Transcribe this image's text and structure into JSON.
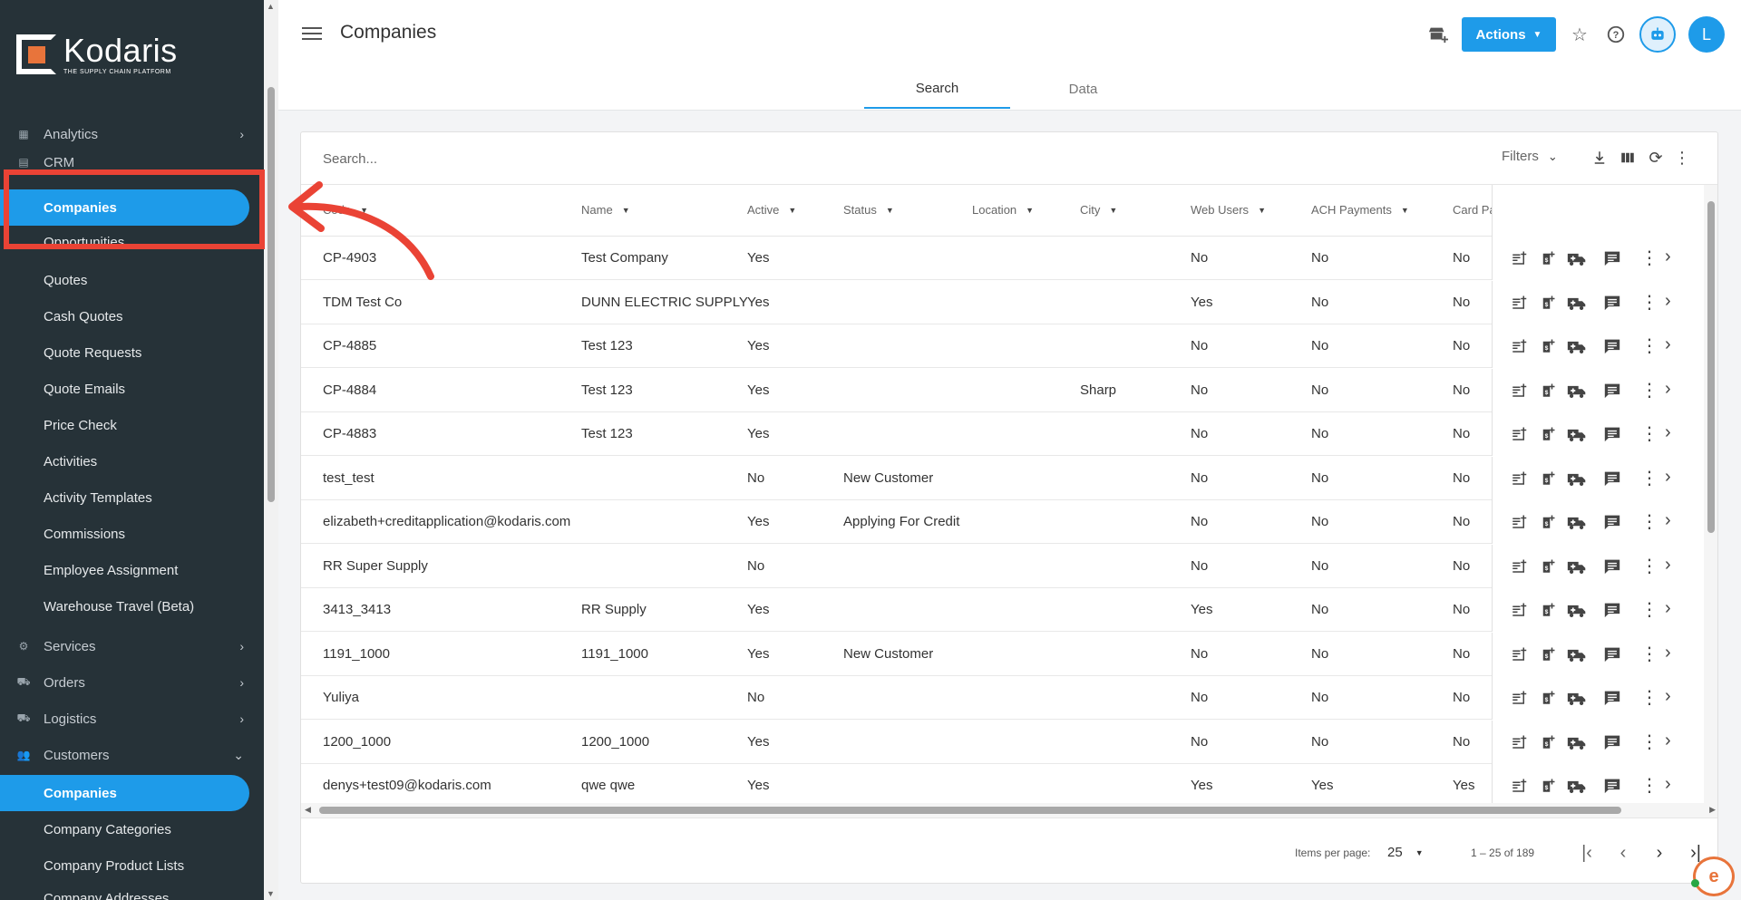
{
  "brand": {
    "name": "Kodaris",
    "tagline": "THE SUPPLY CHAIN PLATFORM"
  },
  "sidebar": {
    "sections": [
      {
        "label": "Analytics",
        "icon": "chart-icon",
        "chevron": "›"
      },
      {
        "label": "CRM",
        "icon": "crm-icon",
        "chevron": ""
      }
    ],
    "crm_items": [
      {
        "label": "Companies",
        "active": true
      },
      {
        "label": "Opportunities"
      },
      {
        "label": "Quotes"
      },
      {
        "label": "Cash Quotes"
      },
      {
        "label": "Quote Requests"
      },
      {
        "label": "Quote Emails"
      },
      {
        "label": "Price Check"
      },
      {
        "label": "Activities"
      },
      {
        "label": "Activity Templates"
      },
      {
        "label": "Commissions"
      },
      {
        "label": "Employee Assignment"
      },
      {
        "label": "Warehouse Travel (Beta)"
      }
    ],
    "lower_sections": [
      {
        "label": "Services",
        "icon": "gears-icon",
        "chevron": "›"
      },
      {
        "label": "Orders",
        "icon": "truck-icon",
        "chevron": "›"
      },
      {
        "label": "Logistics",
        "icon": "shipping-icon",
        "chevron": "›"
      },
      {
        "label": "Customers",
        "icon": "people-icon",
        "chevron": "⌄"
      }
    ],
    "customer_items": [
      {
        "label": "Companies",
        "active": true
      },
      {
        "label": "Company Categories"
      },
      {
        "label": "Company Product Lists"
      },
      {
        "label": "Company Addresses"
      }
    ]
  },
  "header": {
    "title": "Companies",
    "tabs": [
      {
        "label": "Search",
        "active": true
      },
      {
        "label": "Data"
      }
    ],
    "actions_label": "Actions",
    "avatar_initial": "L"
  },
  "search": {
    "placeholder": "Search...",
    "filters_label": "Filters"
  },
  "table": {
    "columns": [
      "Code",
      "Name",
      "Active",
      "Status",
      "Location",
      "City",
      "Web Users",
      "ACH Payments",
      "Card Pa"
    ],
    "rows": [
      {
        "code": "CP-4903",
        "name": "Test Company",
        "active": "Yes",
        "status": "",
        "city": "",
        "web_users": "No",
        "ach": "No",
        "card": "No"
      },
      {
        "code": "TDM Test Co",
        "name": "DUNN ELECTRIC SUPPLY",
        "active": "Yes",
        "status": "",
        "city": "",
        "web_users": "Yes",
        "ach": "No",
        "card": "No"
      },
      {
        "code": "CP-4885",
        "name": "Test 123",
        "active": "Yes",
        "status": "",
        "city": "",
        "web_users": "No",
        "ach": "No",
        "card": "No"
      },
      {
        "code": "CP-4884",
        "name": "Test 123",
        "active": "Yes",
        "status": "",
        "city": "Sharp",
        "web_users": "No",
        "ach": "No",
        "card": "No"
      },
      {
        "code": "CP-4883",
        "name": "Test 123",
        "active": "Yes",
        "status": "",
        "city": "",
        "web_users": "No",
        "ach": "No",
        "card": "No"
      },
      {
        "code": "test_test",
        "name": "",
        "active": "No",
        "status": "New Customer",
        "city": "",
        "web_users": "No",
        "ach": "No",
        "card": "No"
      },
      {
        "code": "elizabeth+creditapplication@kodaris.com",
        "name": "",
        "active": "Yes",
        "status": "Applying For Credit",
        "city": "",
        "web_users": "No",
        "ach": "No",
        "card": "No"
      },
      {
        "code": "RR Super Supply",
        "name": "",
        "active": "No",
        "status": "",
        "city": "",
        "web_users": "No",
        "ach": "No",
        "card": "No"
      },
      {
        "code": "3413_3413",
        "name": "RR Supply",
        "active": "Yes",
        "status": "",
        "city": "",
        "web_users": "Yes",
        "ach": "No",
        "card": "No"
      },
      {
        "code": "1191_1000",
        "name": "1191_1000",
        "active": "Yes",
        "status": "New Customer",
        "city": "",
        "web_users": "No",
        "ach": "No",
        "card": "No"
      },
      {
        "code": "Yuliya",
        "name": "",
        "active": "No",
        "status": "",
        "city": "",
        "web_users": "No",
        "ach": "No",
        "card": "No"
      },
      {
        "code": "1200_1000",
        "name": "1200_1000",
        "active": "Yes",
        "status": "",
        "city": "",
        "web_users": "No",
        "ach": "No",
        "card": "No"
      },
      {
        "code": "denys+test09@kodaris.com",
        "name": "qwe qwe",
        "active": "Yes",
        "status": "",
        "city": "",
        "web_users": "Yes",
        "ach": "Yes",
        "card": "Yes"
      }
    ]
  },
  "paginator": {
    "items_per_page_label": "Items per page:",
    "items_per_page": "25",
    "range": "1 – 25 of 189"
  },
  "colors": {
    "accent": "#1e9be9",
    "sidebar_bg": "#263238",
    "annotation": "#ea4335",
    "brand_orange": "#e8743b"
  }
}
